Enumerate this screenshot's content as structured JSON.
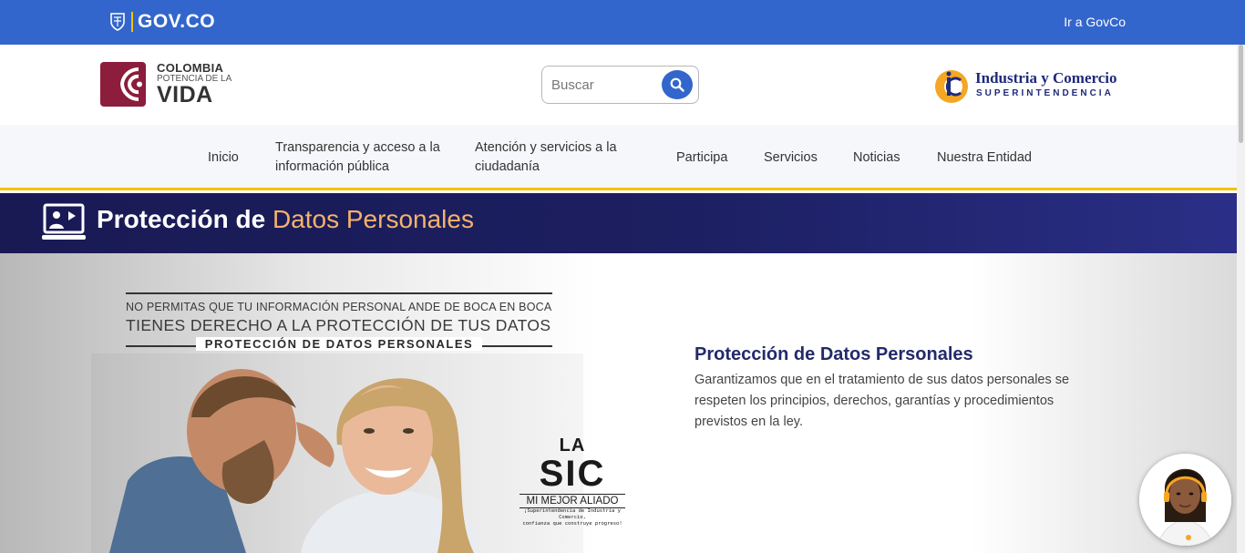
{
  "govbar": {
    "logo_text": "GOV.CO",
    "link": "Ir a GovCo"
  },
  "header": {
    "colombia_logo": {
      "line1": "COLOMBIA",
      "line2": "POTENCIA DE LA",
      "line3": "VIDA"
    },
    "search": {
      "placeholder": "Buscar"
    },
    "sic_logo": {
      "line1": "Industria y Comercio",
      "line2": "SUPERINTENDENCIA"
    }
  },
  "nav": {
    "items": [
      {
        "label": "Inicio"
      },
      {
        "label": "Transparencia y acceso a la información pública"
      },
      {
        "label": "Atención y servicios a la ciudadanía"
      },
      {
        "label": "Participa"
      },
      {
        "label": "Servicios"
      },
      {
        "label": "Noticias"
      },
      {
        "label": "Nuestra Entidad"
      }
    ]
  },
  "banner": {
    "title_bold": "Protección de",
    "title_light": "Datos Personales"
  },
  "hero": {
    "image_text": {
      "line1": "NO PERMITAS QUE TU INFORMACIÓN PERSONAL ANDE DE BOCA EN BOCA",
      "line2": "TIENES DERECHO A LA PROTECCIÓN DE TUS DATOS",
      "line3": "PROTECCIÓN DE DATOS PERSONALES",
      "stamp_la": "LA",
      "stamp_sic": "SIC",
      "stamp_aliado": "MI MEJOR ALIADO",
      "stamp_small1": "¡Superintendencia de Industria y Comercio,",
      "stamp_small2": "confianza que construye progreso!"
    },
    "heading": "Protección de Datos Personales",
    "paragraph": "Garantizamos que en el tratamiento de sus datos personales se respeten los principios, derechos, garantías y procedimientos previstos en la  ley."
  },
  "colors": {
    "govbar": "#3366cc",
    "banner": "#1c1f61",
    "accent": "#f6b26b",
    "nav_border": "#f2c200",
    "heading": "#232a6b"
  }
}
